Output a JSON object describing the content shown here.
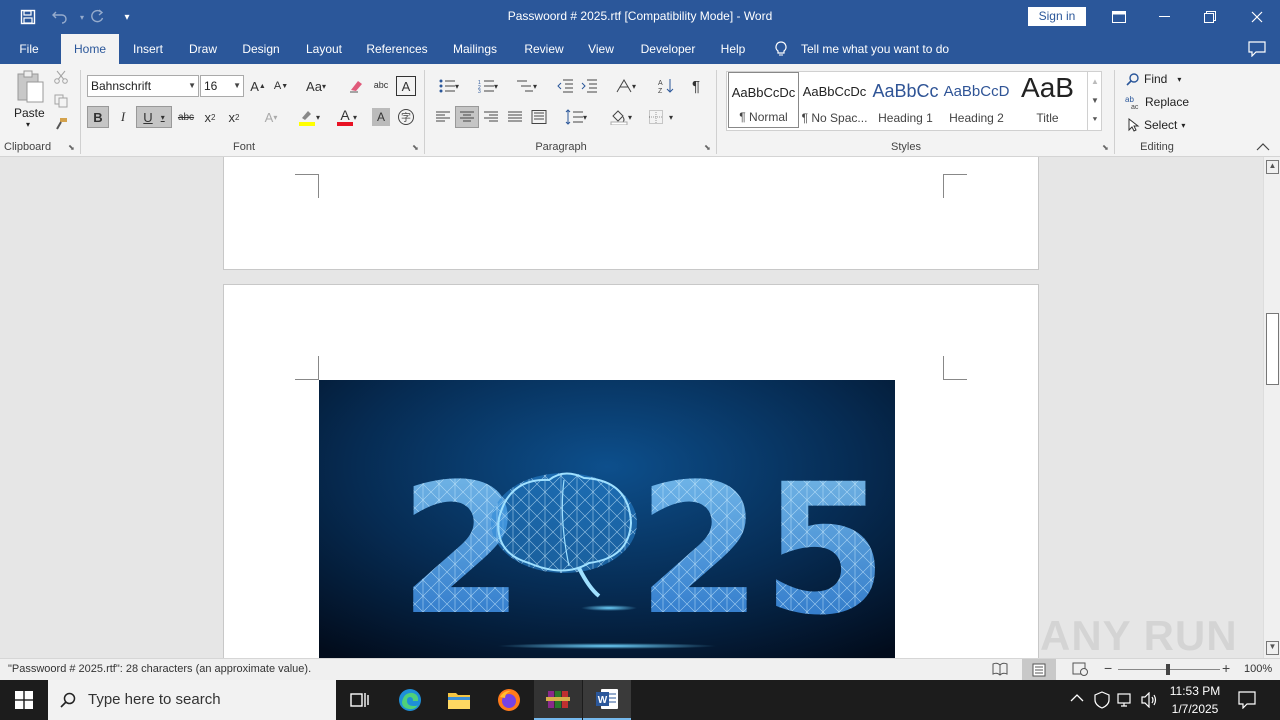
{
  "window": {
    "title": "Passwoord # 2025.rtf [Compatibility Mode]  -  Word",
    "sign_in": "Sign in"
  },
  "tabs": [
    "File",
    "Home",
    "Insert",
    "Draw",
    "Design",
    "Layout",
    "References",
    "Mailings",
    "Review",
    "View",
    "Developer",
    "Help"
  ],
  "tell_me": "Tell me what you want to do",
  "ribbon": {
    "clipboard": {
      "label": "Clipboard",
      "paste": "Paste"
    },
    "font": {
      "label": "Font",
      "name": "Bahnschrift",
      "size": "16"
    },
    "paragraph": {
      "label": "Paragraph"
    },
    "styles": {
      "label": "Styles",
      "items": [
        {
          "sample": "AaBbCcDc",
          "name": "¶ Normal"
        },
        {
          "sample": "AaBbCcDc",
          "name": "¶ No Spac..."
        },
        {
          "sample": "AaBbCc",
          "name": "Heading 1"
        },
        {
          "sample": "AaBbCcD",
          "name": "Heading 2"
        },
        {
          "sample": "AaB",
          "name": "Title"
        }
      ]
    },
    "editing": {
      "label": "Editing",
      "find": "Find",
      "replace": "Replace",
      "select": "Select"
    }
  },
  "document": {
    "image_text": "2025"
  },
  "status": {
    "text": "\"Passwoord # 2025.rtf\": 28 characters (an approximate value).",
    "zoom": "100%"
  },
  "watermark": "ANY RUN",
  "taskbar": {
    "search_placeholder": "Type here to search",
    "time": "11:53 PM",
    "date": "1/7/2025"
  },
  "colors": {
    "word_blue": "#2b579a",
    "ribbon_bg": "#f3f3f3",
    "taskbar": "#1c1c1c"
  }
}
